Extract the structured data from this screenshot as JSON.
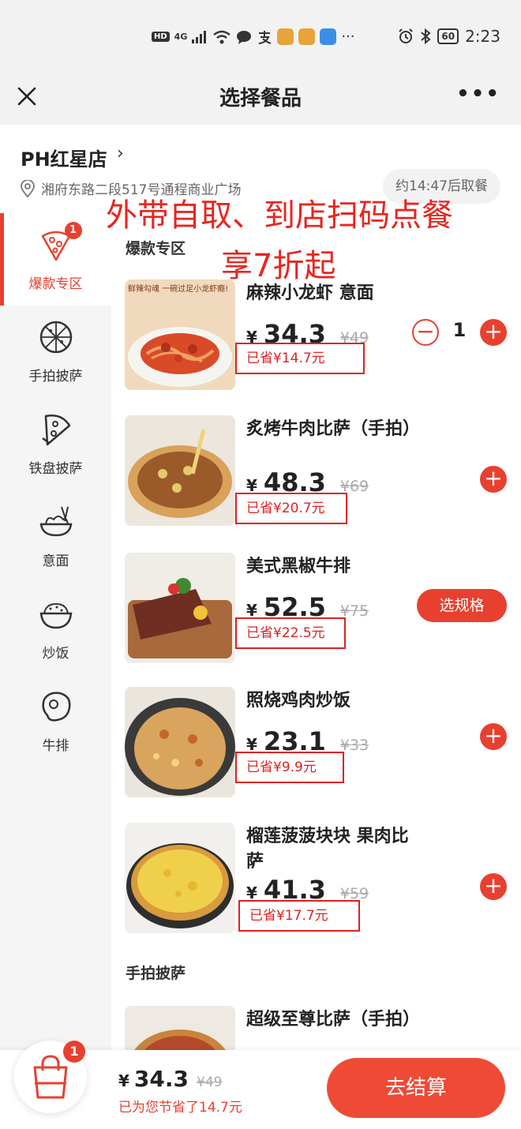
{
  "status_bar": {
    "left_labels": [
      "HD",
      "4G"
    ],
    "time": "2:23",
    "battery": "60",
    "more": "···"
  },
  "nav": {
    "title": "选择餐品",
    "more_label": "•••"
  },
  "store": {
    "name": "PH红星店",
    "chevron": "›",
    "address": "湘府东路二段517号通程商业广场",
    "pickup_time": "约14:47后取餐"
  },
  "promo": {
    "line1": "外带自取、到店扫码点餐",
    "line2": "享7折起"
  },
  "categories": [
    {
      "label": "爆款专区",
      "active": true,
      "badge": "1",
      "icon": "pizza-slice-icon"
    },
    {
      "label": "手拍披萨",
      "active": false,
      "icon": "whole-pizza-icon"
    },
    {
      "label": "铁盘披萨",
      "active": false,
      "icon": "pan-pizza-icon"
    },
    {
      "label": "意面",
      "active": false,
      "icon": "pasta-bowl-icon"
    },
    {
      "label": "炒饭",
      "active": false,
      "icon": "rice-bowl-icon"
    },
    {
      "label": "牛排",
      "active": false,
      "icon": "steak-icon"
    }
  ],
  "sections": [
    {
      "title": "爆款专区"
    },
    {
      "title": "手拍披萨"
    }
  ],
  "products": [
    {
      "name": "麻辣小龙虾 意面",
      "yen": "¥",
      "price": "34.3",
      "orig": "¥49",
      "saved": "已省¥14.7元",
      "action": "qty",
      "qty": "1",
      "image_text": "鲜辣勾魂 一碗过足小龙虾瘾!"
    },
    {
      "name": "炙烤牛肉比萨（手拍）",
      "yen": "¥",
      "price": "48.3",
      "orig": "¥69",
      "saved": "已省¥20.7元",
      "action": "plus"
    },
    {
      "name": "美式黑椒牛排",
      "yen": "¥",
      "price": "52.5",
      "orig": "¥75",
      "saved": "已省¥22.5元",
      "action": "spec",
      "spec_label": "选规格"
    },
    {
      "name": "照烧鸡肉炒饭",
      "yen": "¥",
      "price": "23.1",
      "orig": "¥33",
      "saved": "已省¥9.9元",
      "action": "plus"
    },
    {
      "name": "榴莲菠菠块块 果肉比萨",
      "yen": "¥",
      "price": "41.3",
      "orig": "¥59",
      "saved": "已省¥17.7元",
      "action": "plus"
    },
    {
      "name": "超级至尊比萨（手拍）"
    }
  ],
  "buttons": {
    "plus": "+",
    "minus": "−"
  },
  "cart": {
    "badge": "1",
    "yen": "¥",
    "total": "34.3",
    "orig": "¥49",
    "saved_note": "已为您节省了14.7元",
    "checkout": "去结算"
  },
  "colors": {
    "accent": "#e8402f",
    "annotation_red": "#e02020"
  }
}
